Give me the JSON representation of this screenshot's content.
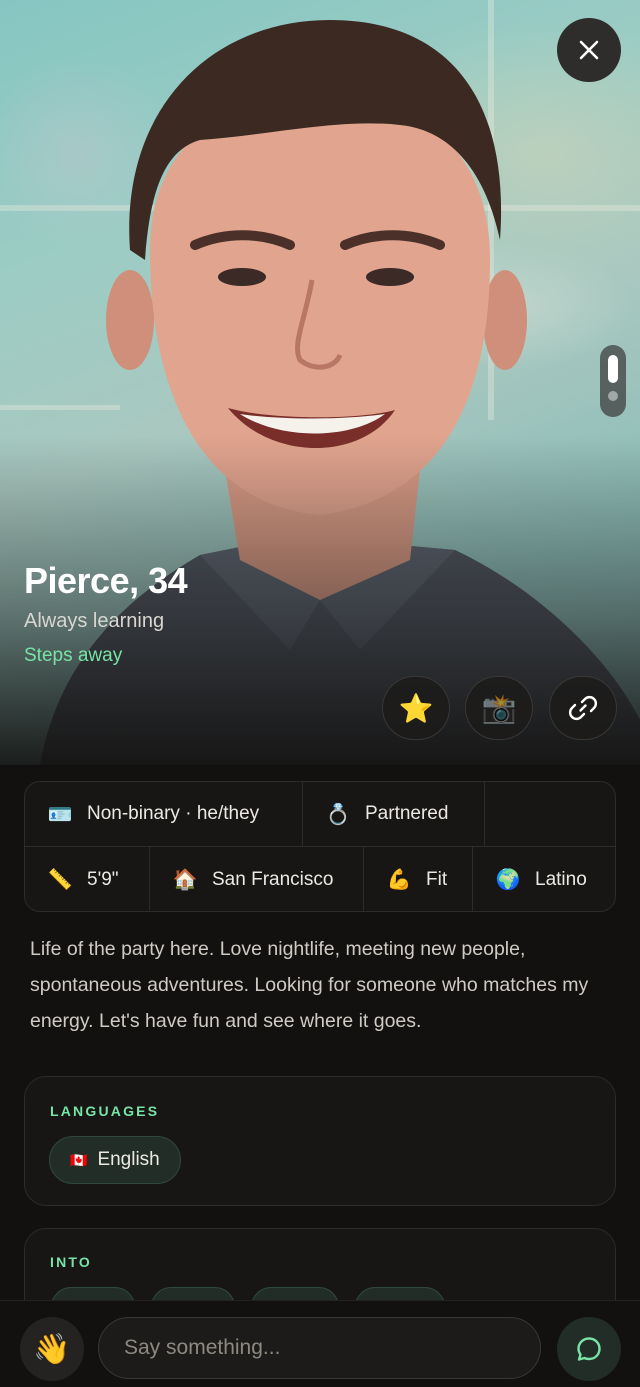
{
  "profile": {
    "name": "Pierce, 34",
    "tagline": "Always learning",
    "distance": "Steps away",
    "photo_alt": "profile photo"
  },
  "photo_pager": {
    "active_index": 0,
    "count": 2
  },
  "actions": {
    "close_icon": "close-icon",
    "star_icon": "star-icon",
    "camera_icon": "camera-icon",
    "link_icon": "link-icon"
  },
  "details": {
    "row1": [
      {
        "icon": "id-card-icon",
        "label": "Non-binary · he/they"
      },
      {
        "icon": "ring-icon",
        "label": "Partnered"
      }
    ],
    "row2": [
      {
        "icon": "ruler-icon",
        "label": "5'9\""
      },
      {
        "icon": "house-icon",
        "label": "San Francisco"
      },
      {
        "icon": "flexed-biceps-icon",
        "label": "Fit"
      },
      {
        "icon": "globe-icon",
        "label": "Latino"
      }
    ]
  },
  "bio": "Life of the party here. Love nightlife, meeting new people, spontaneous adventures. Looking for someone who matches my energy. Let's have fun and see where it goes.",
  "languages": {
    "title": "LANGUAGES",
    "items": [
      {
        "flag": "canada-flag-icon",
        "label": "English"
      }
    ]
  },
  "into": {
    "title": "INTO"
  },
  "composer": {
    "wave_icon": "waving-hand-icon",
    "placeholder": "Say something...",
    "value": "",
    "send_icon": "chat-bubble-icon"
  },
  "colors": {
    "background": "#121110",
    "accent": "#78E3A6",
    "card": "#171615",
    "border": "#2E2C2A"
  }
}
